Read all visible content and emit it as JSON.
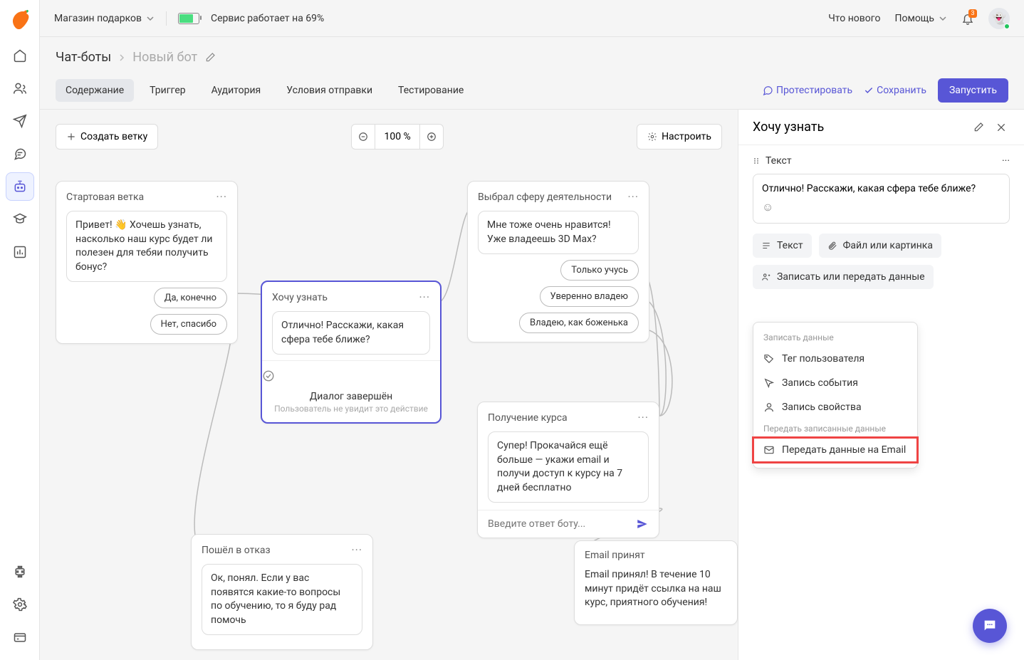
{
  "store_name": "Магазин подарков",
  "service_status": "Сервис работает на 69%",
  "topnav": {
    "whats_new": "Что нового",
    "help": "Помощь",
    "notif_count": "3"
  },
  "breadcrumb": {
    "root": "Чат-боты",
    "current": "Новый бот"
  },
  "tabs": {
    "content": "Содержание",
    "trigger": "Триггер",
    "audience": "Аудитория",
    "conditions": "Условия отправки",
    "testing": "Тестирование"
  },
  "actions": {
    "test": "Протестировать",
    "save": "Сохранить",
    "launch": "Запустить"
  },
  "toolbar": {
    "create_branch": "Создать ветку",
    "zoom": "100 %",
    "configure": "Настроить"
  },
  "cards": {
    "start": {
      "title": "Стартовая ветка",
      "msg": "Привет! 👋 Хочешь узнать, насколько наш курс будет ли полезен для тебяи получить бонус?",
      "r1": "Да, конечно",
      "r2": "Нет, спасибо"
    },
    "want": {
      "title": "Хочу узнать",
      "msg": "Отлично! Расскажи, какая сфера тебе ближе?",
      "done": "Диалог завершён",
      "done_sub": "Пользователь не увидит это действие"
    },
    "sphere": {
      "title": "Выбрал сферу деятельности",
      "msg": "Мне тоже очень нравится! Уже владеешь 3D Max?",
      "r1": "Только учусь",
      "r2": "Уверенно владею",
      "r3": "Владею, как боженька"
    },
    "course": {
      "title": "Получение курса",
      "msg": "Супер! Прокачайся ещё больше — укажи email и получи доступ к курсу на 7 дней бесплатно",
      "placeholder": "Введите ответ боту..."
    },
    "refuse": {
      "title": "Пошёл в отказ",
      "msg": "Ок, понял. Если у вас появятся какие-то вопросы по обучению, то я буду рад помочь"
    },
    "email": {
      "title": "Email принят",
      "msg": "Email принял! В течение 10 минут придёт ссылка на наш курс, приятного обучения!"
    }
  },
  "panel": {
    "title": "Хочу узнать",
    "block": "Текст",
    "text": "Отлично! Расскажи, какая сфера тебе ближе?",
    "btn_text": "Текст",
    "btn_file": "Файл или картинка",
    "btn_data": "Записать или передать данные"
  },
  "menu": {
    "g1": "Записать данные",
    "i1": "Тег пользователя",
    "i2": "Запись события",
    "i3": "Запись свойства",
    "g2": "Передать записанные данные",
    "i4": "Передать данные на Email"
  }
}
